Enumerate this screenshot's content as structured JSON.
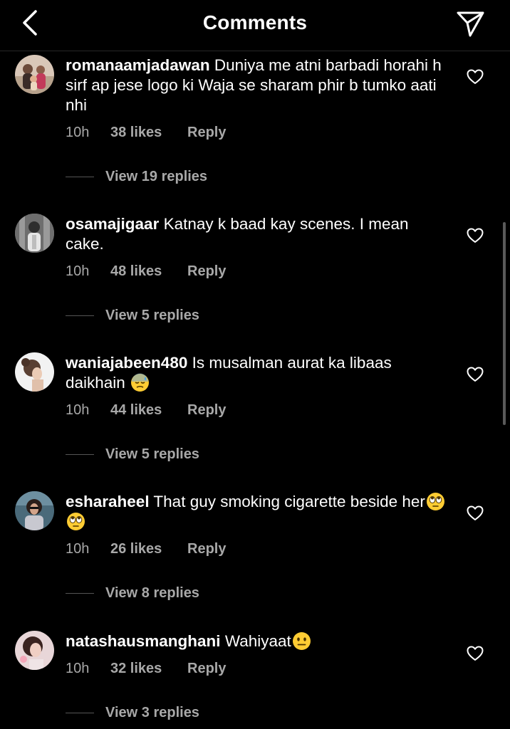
{
  "header": {
    "title": "Comments",
    "back_icon": "chevron-left-icon",
    "share_icon": "paper-plane-icon"
  },
  "comments": [
    {
      "username": "romanaamjadawan",
      "text": " Duniya me atni barbadi horahi h sirf ap jese logo ki Waja se sharam phir b tumko aati nhi",
      "time": "10h",
      "likes": "38 likes",
      "reply": "Reply",
      "view_replies": "View 19 replies"
    },
    {
      "username": "osamajigaar",
      "text": " Katnay k baad kay scenes. I mean cake.",
      "time": "10h",
      "likes": "48 likes",
      "reply": "Reply",
      "view_replies": "View 5 replies"
    },
    {
      "username": "waniajabeen480",
      "text": " Is musalman aurat ka libaas daikhain ",
      "emojis": [
        "downcast-sweat-face-emoji"
      ],
      "time": "10h",
      "likes": "44 likes",
      "reply": "Reply",
      "view_replies": "View 5 replies"
    },
    {
      "username": "esharaheel",
      "text": " That guy smoking cigarette beside her",
      "emojis": [
        "eye-roll-face-emoji",
        "eye-roll-face-emoji"
      ],
      "time": "10h",
      "likes": "26 likes",
      "reply": "Reply",
      "view_replies": "View 8 replies"
    },
    {
      "username": "natashausmanghani",
      "text": " Wahiyaat",
      "emojis": [
        "neutral-face-emoji"
      ],
      "time": "10h",
      "likes": "32 likes",
      "reply": "Reply",
      "view_replies": "View 3 replies"
    }
  ],
  "colors": {
    "background": "#000000",
    "text": "#ffffff",
    "secondary_text": "#a8a8a8",
    "emoji_yellow": "#ffcc33"
  }
}
